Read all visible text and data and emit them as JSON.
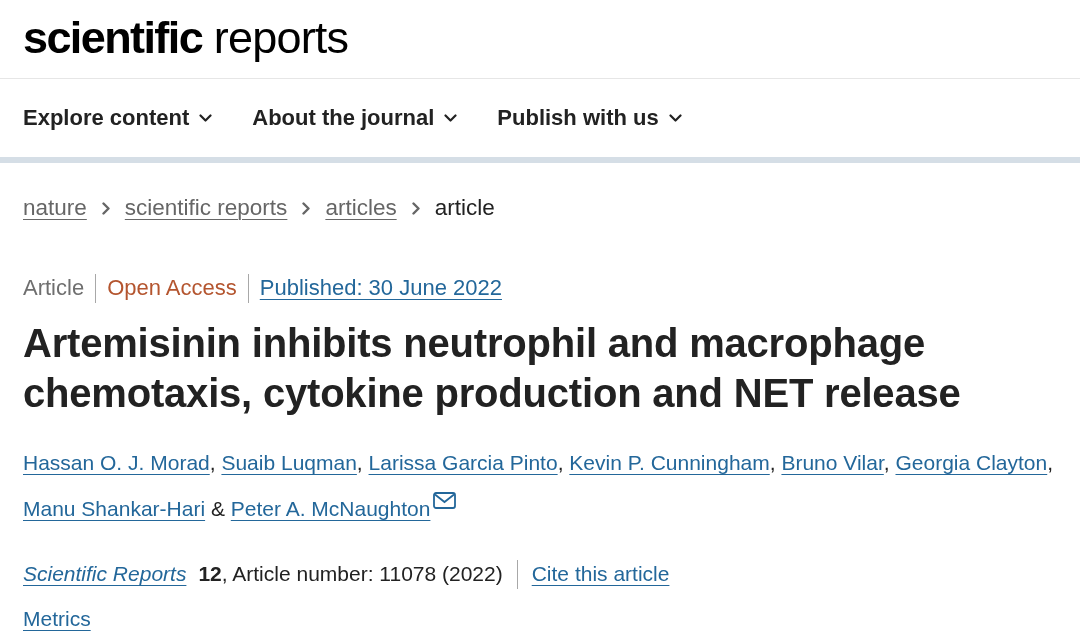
{
  "header": {
    "logo": "**scientific** reports"
  },
  "nav": {
    "items": [
      {
        "label": "Explore content"
      },
      {
        "label": "About the journal"
      },
      {
        "label": "Publish with us"
      }
    ]
  },
  "breadcrumbs": [
    {
      "label": "nature",
      "current": false
    },
    {
      "label": "scientific reports",
      "current": false
    },
    {
      "label": "articles",
      "current": false
    },
    {
      "label": "article",
      "current": true
    }
  ],
  "article": {
    "meta": [
      {
        "kind": "type",
        "text": "Article"
      },
      {
        "kind": "access",
        "text": "Open Access"
      },
      {
        "kind": "date",
        "text": "Published: 30 June 2022"
      }
    ],
    "title": "Artemisinin inhibits neutrophil and macrophage chemotaxis, cytokine production and NET release",
    "authors": {
      "list": [
        {
          "name": "Hassan O. J. Morad",
          "punct": ","
        },
        {
          "name": "Suaib Luqman",
          "punct": ","
        },
        {
          "name": "Larissa Garcia Pinto",
          "punct": ","
        },
        {
          "name": "Kevin P. Cunningham",
          "punct": ","
        },
        {
          "name": "Bruno Vilar",
          "punct": ","
        },
        {
          "name": "Georgia Clayton",
          "punct": ","
        },
        {
          "name": "Manu Shankar-Hari"
        },
        {
          "name": "Peter A. McNaughton",
          "corresponding": true
        }
      ],
      "conjunction": "&"
    },
    "citation": {
      "journal": "Scientific Reports",
      "details": "**12**, Article number: 11078 (2022)",
      "cite_link": "Cite this article"
    },
    "metrics": "Metrics"
  }
}
